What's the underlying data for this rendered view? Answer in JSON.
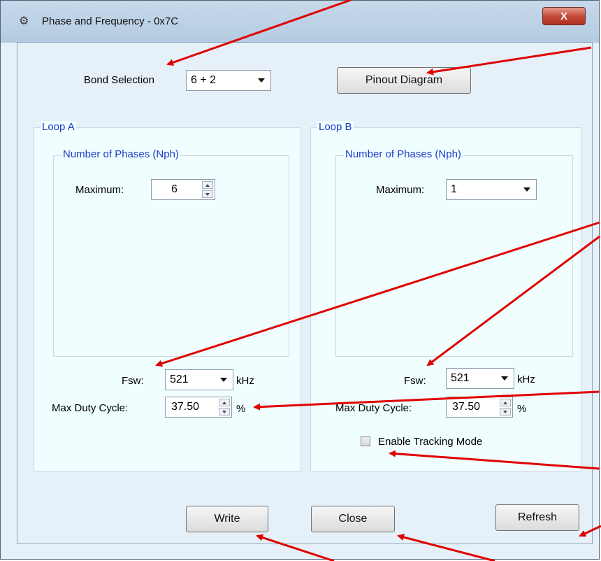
{
  "window": {
    "title": "Phase and Frequency - 0x7C",
    "close_label": "X",
    "title_icon": "app-gear-icon"
  },
  "bond": {
    "label": "Bond Selection",
    "value": "6 + 2"
  },
  "pinout_button": "Pinout Diagram",
  "loop_a": {
    "title": "Loop A",
    "phases_group": "Number of Phases (Nph)",
    "max_label": "Maximum:",
    "max_value": "6",
    "fsw_label": "Fsw:",
    "fsw_value": "521",
    "fsw_unit": "kHz",
    "duty_label": "Max Duty Cycle:",
    "duty_value": "37.50",
    "duty_unit": "%"
  },
  "loop_b": {
    "title": "Loop B",
    "phases_group": "Number of Phases (Nph)",
    "max_label": "Maximum:",
    "max_value": "1",
    "fsw_label": "Fsw:",
    "fsw_value": "521",
    "fsw_unit": "kHz",
    "duty_label": "Max Duty Cycle:",
    "duty_value": "37.50",
    "duty_unit": "%",
    "tracking_label": "Enable Tracking Mode",
    "tracking_checked": false
  },
  "buttons": {
    "write": "Write",
    "close": "Close",
    "refresh": "Refresh"
  },
  "colors": {
    "annotation_arrow": "#e00000",
    "group_title": "#1a3cc8",
    "group_bg": "#f0feff"
  }
}
